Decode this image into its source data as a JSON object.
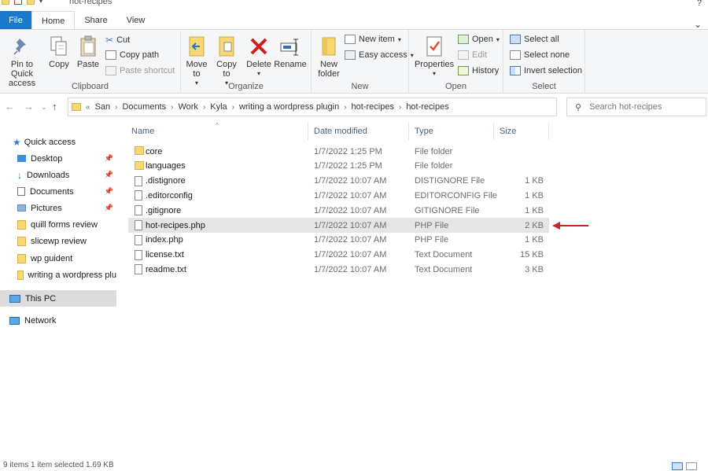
{
  "window": {
    "title": "hot-recipes",
    "help": "?"
  },
  "tabs": [
    {
      "label": "File"
    },
    {
      "label": "Home"
    },
    {
      "label": "Share"
    },
    {
      "label": "View"
    }
  ],
  "ribbon": {
    "clipboard": {
      "label": "Clipboard",
      "pin": "Pin to Quick access",
      "copy": "Copy",
      "paste": "Paste",
      "cut": "Cut",
      "copy_path": "Copy path",
      "paste_shortcut": "Paste shortcut"
    },
    "organize": {
      "label": "Organize",
      "move_to": "Move to",
      "copy_to": "Copy to",
      "delete": "Delete",
      "rename": "Rename"
    },
    "new": {
      "label": "New",
      "new_folder": "New folder",
      "new_item": "New item",
      "easy_access": "Easy access"
    },
    "open": {
      "label": "Open",
      "properties": "Properties",
      "open": "Open",
      "edit": "Edit",
      "history": "History"
    },
    "select": {
      "label": "Select",
      "select_all": "Select all",
      "select_none": "Select none",
      "invert_selection": "Invert selection"
    }
  },
  "address": {
    "overflow": "«",
    "crumbs": [
      "San",
      "Documents",
      "Work",
      "Kyla",
      "writing a wordpress plugin",
      "hot-recipes",
      "hot-recipes"
    ],
    "search_placeholder": "Search hot-recipes"
  },
  "nav": {
    "quick_access": "Quick access",
    "items": [
      {
        "label": "Desktop",
        "pinned": true
      },
      {
        "label": "Downloads",
        "pinned": true
      },
      {
        "label": "Documents",
        "pinned": true
      },
      {
        "label": "Pictures",
        "pinned": true
      },
      {
        "label": "quill forms review",
        "pinned": false
      },
      {
        "label": "slicewp review",
        "pinned": false
      },
      {
        "label": "wp guident",
        "pinned": false
      },
      {
        "label": "writing a wordpress plu",
        "pinned": false
      }
    ],
    "this_pc": "This PC",
    "network": "Network"
  },
  "columns": {
    "name": "Name",
    "date": "Date modified",
    "type": "Type",
    "size": "Size"
  },
  "files": [
    {
      "name": "core",
      "date": "1/7/2022 1:25 PM",
      "type": "File folder",
      "size": "",
      "kind": "folder"
    },
    {
      "name": "languages",
      "date": "1/7/2022 1:25 PM",
      "type": "File folder",
      "size": "",
      "kind": "folder"
    },
    {
      "name": ".distignore",
      "date": "1/7/2022 10:07 AM",
      "type": "DISTIGNORE File",
      "size": "1 KB",
      "kind": "file"
    },
    {
      "name": ".editorconfig",
      "date": "1/7/2022 10:07 AM",
      "type": "EDITORCONFIG File",
      "size": "1 KB",
      "kind": "file"
    },
    {
      "name": ".gitignore",
      "date": "1/7/2022 10:07 AM",
      "type": "GITIGNORE File",
      "size": "1 KB",
      "kind": "file"
    },
    {
      "name": "hot-recipes.php",
      "date": "1/7/2022 10:07 AM",
      "type": "PHP File",
      "size": "2 KB",
      "kind": "file"
    },
    {
      "name": "index.php",
      "date": "1/7/2022 10:07 AM",
      "type": "PHP File",
      "size": "1 KB",
      "kind": "file"
    },
    {
      "name": "license.txt",
      "date": "1/7/2022 10:07 AM",
      "type": "Text Document",
      "size": "15 KB",
      "kind": "file"
    },
    {
      "name": "readme.txt",
      "date": "1/7/2022 10:07 AM",
      "type": "Text Document",
      "size": "3 KB",
      "kind": "file"
    }
  ],
  "status": {
    "text": "9 items    1 item selected  1.69 KB"
  },
  "colors": {
    "file_tab": "#1979ca",
    "folder": "#f8d775",
    "annotation_arrow": "#d42020",
    "selected_row": "#e5e5e5"
  }
}
